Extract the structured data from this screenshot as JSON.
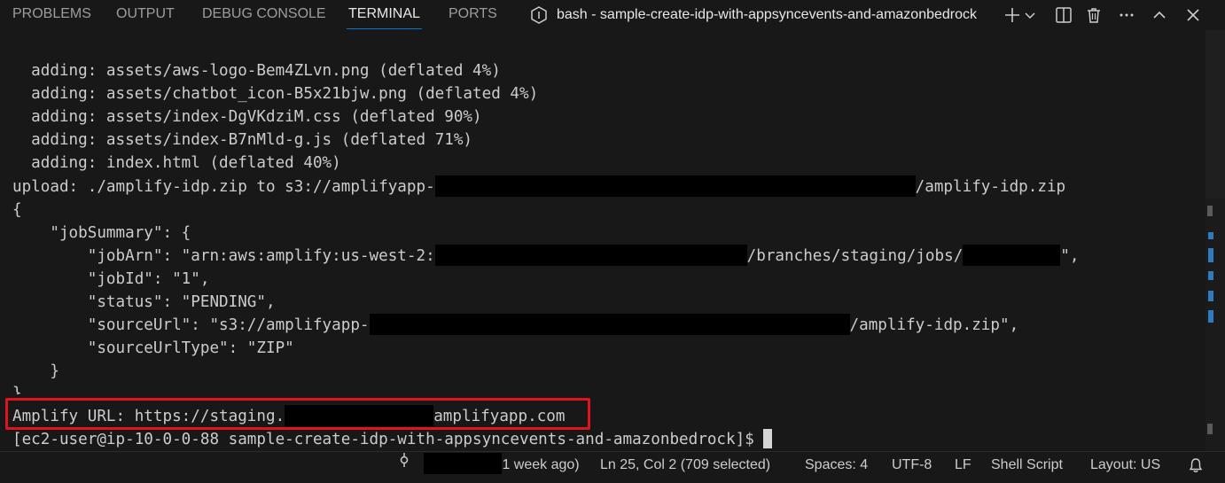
{
  "panel": {
    "tabs": [
      {
        "label": "PROBLEMS",
        "active": false
      },
      {
        "label": "OUTPUT",
        "active": false
      },
      {
        "label": "DEBUG CONSOLE",
        "active": false
      },
      {
        "label": "TERMINAL",
        "active": true
      },
      {
        "label": "PORTS",
        "active": false
      }
    ],
    "terminal_name": "bash - sample-create-idp-with-appsyncevents-and-amazonbedrock",
    "controls": [
      "plus-icon",
      "chevron-down-icon",
      "split-icon",
      "trash-icon",
      "more-icon",
      "chevron-up-icon",
      "close-icon"
    ]
  },
  "terminal": {
    "lines": [
      "  adding: assets/aws-logo-Bem4ZLvn.png (deflated 4%)",
      "  adding: assets/chatbot_icon-B5x21bjw.png (deflated 4%)",
      "  adding: assets/index-DgVKdziM.css (deflated 90%)",
      "  adding: assets/index-B7nMld-g.js (deflated 71%)",
      "  adding: index.html (deflated 40%)"
    ],
    "upload_prefix": "upload: ./amplify-idp.zip to s3://amplifyapp-",
    "upload_suffix": "/amplify-idp.zip",
    "brace_open": "{",
    "job_summary_key": "    \"jobSummary\": {",
    "job_arn_prefix": "        \"jobArn\": \"arn:aws:amplify:us-west-2:",
    "job_arn_mid": "/branches/staging/jobs/",
    "job_arn_suffix": "\",",
    "job_id": "        \"jobId\": \"1\",",
    "status": "        \"status\": \"PENDING\",",
    "source_url_prefix": "        \"sourceUrl\": \"s3://amplifyapp-",
    "source_url_suffix": "/amplify-idp.zip\",",
    "source_url_type": "        \"sourceUrlType\": \"ZIP\"",
    "inner_close": "    }",
    "brace_close": "}",
    "amplify_url_prefix": "Amplify URL: https://staging.",
    "amplify_url_suffix": "amplifyapp.com",
    "prompt": "[ec2-user@ip-10-0-0-88 sample-create-idp-with-appsyncevents-and-amazonbedrock]$"
  },
  "status_bar": {
    "commit_age": "1 week ago)",
    "cursor_position": "Ln 25, Col 2 (709 selected)",
    "spaces": "Spaces: 4",
    "encoding": "UTF-8",
    "eol": "LF",
    "language": "Shell Script",
    "layout": "Layout: US"
  },
  "colors": {
    "background": "#181818",
    "text": "#cccccc",
    "active_tab_underline": "#0078d4",
    "highlight_box": "#e0141e",
    "redaction": "#000000"
  }
}
